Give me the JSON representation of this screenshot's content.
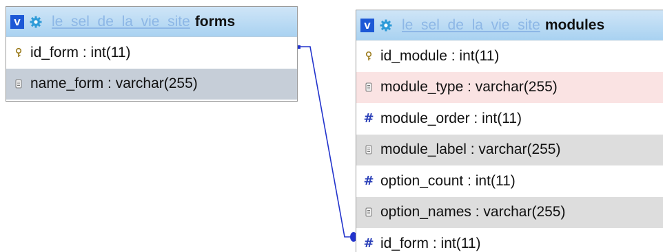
{
  "tables": [
    {
      "id": "forms",
      "database": "le_sel_de_la_vie_site",
      "name": "forms",
      "columns": [
        {
          "label": "id_form : int(11)",
          "icon": "key-icon",
          "style": "plain"
        },
        {
          "label": "name_form : varchar(255)",
          "icon": "text-field-icon",
          "style": "sel"
        }
      ]
    },
    {
      "id": "modules",
      "database": "le_sel_de_la_vie_site",
      "name": "modules",
      "columns": [
        {
          "label": "id_module : int(11)",
          "icon": "key-icon",
          "style": "plain"
        },
        {
          "label": "module_type : varchar(255)",
          "icon": "text-field-icon",
          "style": "hl"
        },
        {
          "label": "module_order : int(11)",
          "icon": "hash-icon",
          "style": "plain"
        },
        {
          "label": "module_label : varchar(255)",
          "icon": "text-field-icon",
          "style": "alt"
        },
        {
          "label": "option_count : int(11)",
          "icon": "hash-icon",
          "style": "plain"
        },
        {
          "label": "option_names : varchar(255)",
          "icon": "text-field-icon",
          "style": "alt"
        },
        {
          "label": "id_form : int(11)",
          "icon": "hash-icon",
          "style": "plain"
        }
      ]
    }
  ],
  "header_toggle": "v",
  "relation": {
    "from": "forms.id_form",
    "to": "modules.id_form"
  },
  "colors": {
    "toggle_bg": "#1c58d6",
    "header_gradient_top": "#cfe5f7",
    "header_gradient_bottom": "#a9d2f1",
    "db_link": "#8db7e6",
    "relation_line": "#2233cc",
    "row_highlight": "#fae3e3",
    "row_alt": "#dddddd",
    "row_selected": "#c6ced8"
  }
}
